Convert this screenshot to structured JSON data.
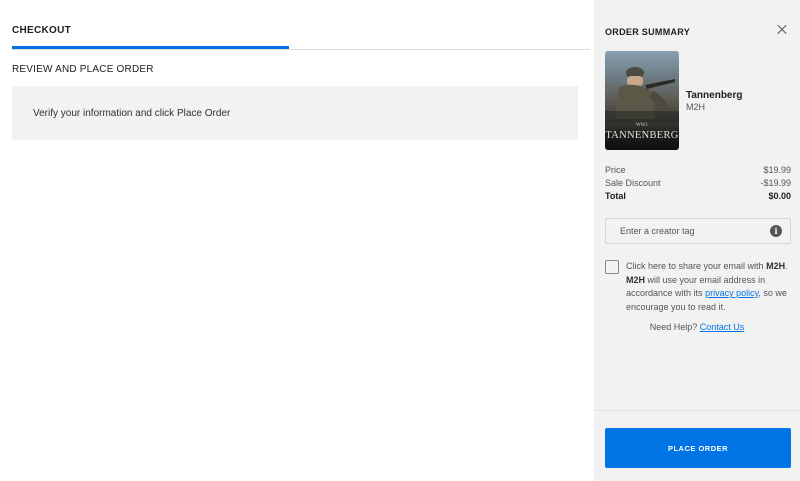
{
  "checkout": {
    "tab_label": "CHECKOUT",
    "progress": 0.48,
    "section_title": "REVIEW AND PLACE ORDER",
    "notice_text": "Verify your information and click Place Order"
  },
  "summary": {
    "title": "ORDER SUMMARY",
    "close_icon": "close-icon",
    "product": {
      "name": "Tannenberg",
      "publisher": "M2H",
      "cover_title": "TANNENBERG",
      "cover_subtitle": "WW1"
    },
    "price": {
      "label": "Price",
      "value": "$19.99"
    },
    "discount": {
      "label": "Sale Discount",
      "value": "-$19.99"
    },
    "total": {
      "label": "Total",
      "value": "$0.00"
    },
    "creator_tag": {
      "placeholder": "Enter a creator tag",
      "value": "",
      "icon": "info-icon"
    },
    "consent": {
      "part1": "Click here to share your email with",
      "brand1": "M2H",
      "part2": ".",
      "brand2": "M2H",
      "part3": "will use your email address in accordance with its",
      "link": "privacy policy",
      "part4": ", so we encourage you to read it."
    },
    "help": {
      "text": "Need Help?",
      "link": "Contact Us"
    },
    "place_order_label": "PLACE ORDER"
  },
  "colors": {
    "accent": "#0074e4",
    "panel": "#f2f2f2"
  }
}
